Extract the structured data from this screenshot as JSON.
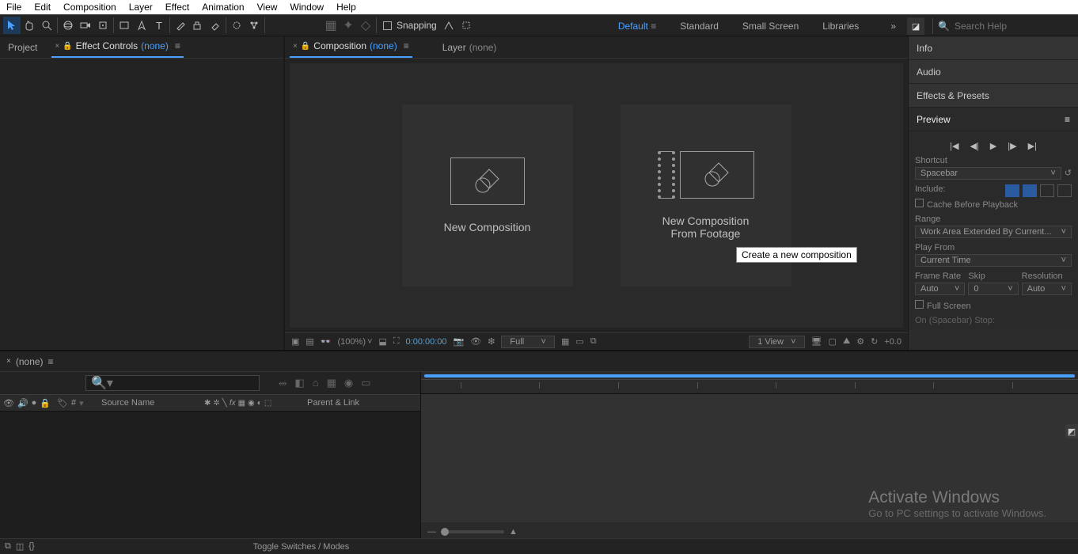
{
  "menu": [
    "File",
    "Edit",
    "Composition",
    "Layer",
    "Effect",
    "Animation",
    "View",
    "Window",
    "Help"
  ],
  "toolbar": {
    "snapping": "Snapping"
  },
  "workspaces": {
    "items": [
      "Default",
      "Standard",
      "Small Screen",
      "Libraries"
    ],
    "active": 0
  },
  "search": {
    "placeholder": "Search Help"
  },
  "left": {
    "tabs": {
      "project": "Project",
      "effect_controls": "Effect Controls",
      "none": "(none)"
    }
  },
  "center": {
    "tabs": {
      "composition": "Composition",
      "none": "(none)",
      "layer": "Layer",
      "layer_none": "(none)"
    },
    "new_comp": "New Composition",
    "from_footage_l1": "New Composition",
    "from_footage_l2": "From Footage",
    "tooltip": "Create a new composition"
  },
  "viewer": {
    "mag": "(100%)",
    "time": "0:00:00:00",
    "res": "Full",
    "views": "1 View",
    "exposure": "+0.0"
  },
  "right": {
    "info": "Info",
    "audio": "Audio",
    "ep": "Effects & Presets",
    "preview": "Preview",
    "shortcut": "Shortcut",
    "spacebar": "Spacebar",
    "include": "Include:",
    "cache": "Cache Before Playback",
    "range_lbl": "Range",
    "range_val": "Work Area Extended By Current...",
    "playfrom_lbl": "Play From",
    "playfrom_val": "Current Time",
    "fr": "Frame Rate",
    "skip": "Skip",
    "res": "Resolution",
    "auto": "Auto",
    "zero": "0",
    "fullscreen": "Full Screen",
    "onstop": "On (Spacebar) Stop:"
  },
  "timeline": {
    "tab": "(none)",
    "cols": {
      "hash": "#",
      "source": "Source Name",
      "parent": "Parent & Link"
    },
    "footer": "Toggle Switches / Modes"
  },
  "watermark": {
    "title": "Activate Windows",
    "sub": "Go to PC settings to activate Windows."
  }
}
